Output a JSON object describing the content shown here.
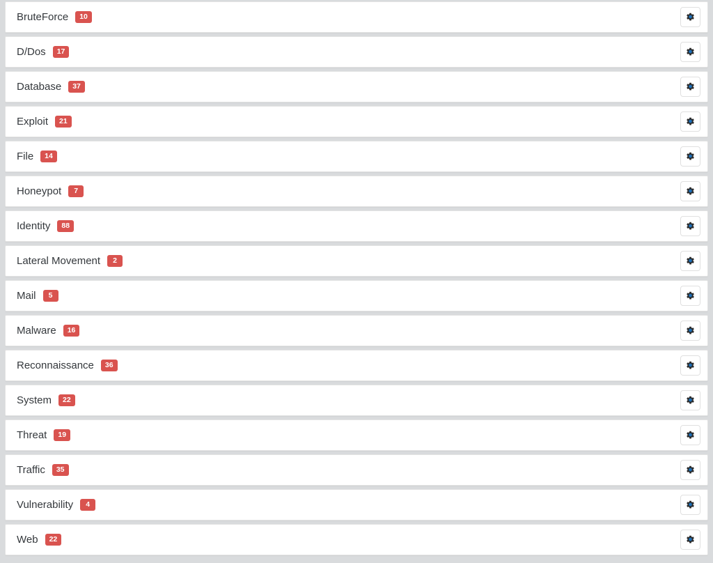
{
  "colors": {
    "page_background": "#d9dbdd",
    "row_background": "#ffffff",
    "badge_background": "#d9534f",
    "badge_text": "#ffffff",
    "label_text": "#34383c",
    "button_border": "#e0e0e0"
  },
  "list": {
    "name": "alert-category-list",
    "settings_icon": "gear-icon",
    "settings_button_label": "Settings",
    "rows": [
      {
        "label": "BruteForce",
        "count": "10"
      },
      {
        "label": "D/Dos",
        "count": "17"
      },
      {
        "label": "Database",
        "count": "37"
      },
      {
        "label": "Exploit",
        "count": "21"
      },
      {
        "label": "File",
        "count": "14"
      },
      {
        "label": "Honeypot",
        "count": "7"
      },
      {
        "label": "Identity",
        "count": "88"
      },
      {
        "label": "Lateral Movement",
        "count": "2"
      },
      {
        "label": "Mail",
        "count": "5"
      },
      {
        "label": "Malware",
        "count": "16"
      },
      {
        "label": "Reconnaissance",
        "count": "36"
      },
      {
        "label": "System",
        "count": "22"
      },
      {
        "label": "Threat",
        "count": "19"
      },
      {
        "label": "Traffic",
        "count": "35"
      },
      {
        "label": "Vulnerability",
        "count": "4"
      },
      {
        "label": "Web",
        "count": "22"
      }
    ]
  }
}
